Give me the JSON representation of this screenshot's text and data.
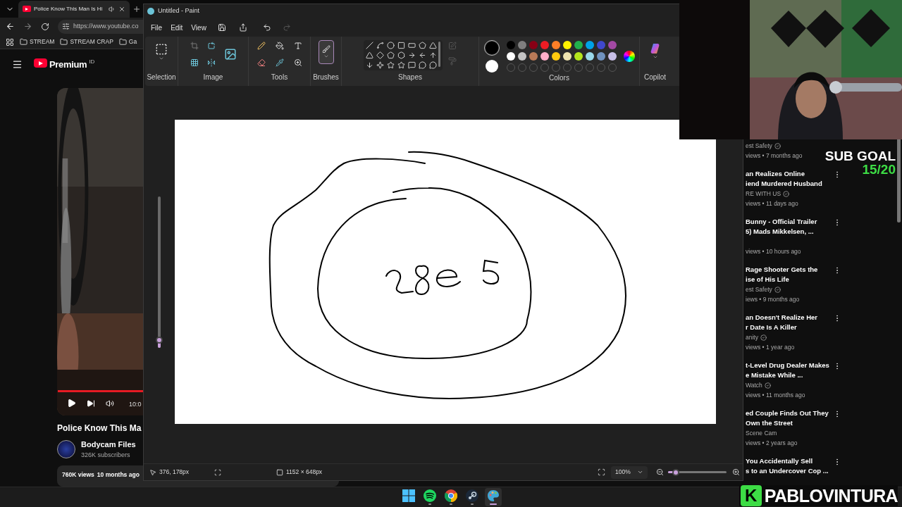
{
  "browser": {
    "tab": {
      "title": "Police Know This Man Is Hi",
      "selected": true
    },
    "address": "https://www.youtube.co",
    "bookmarks": [
      "STREAM",
      "STREAM CRAP",
      "Ga"
    ],
    "logo": "Premium",
    "logo_badge": "ID",
    "video": {
      "time": "10:0",
      "title": "Police Know This Ma",
      "channel": "Bodycam Files",
      "subscribers": "326K subscribers",
      "views": "760K views",
      "age": "10 months ago"
    },
    "recommendations": [
      {
        "channel": "est Safety",
        "verified": true,
        "meta": "views • 7 months ago"
      },
      {
        "title_lines": [
          "an Realizes Online",
          "iend Murdered Husband"
        ],
        "channel": "RE WITH US",
        "verified": true,
        "meta": "views • 11 days ago"
      },
      {
        "title_lines": [
          "Bunny - Official Trailer",
          "5) Mads Mikkelsen, ..."
        ],
        "meta": "views • 10 hours ago"
      },
      {
        "title_lines": [
          "Rage Shooter Gets the",
          "ise of His Life"
        ],
        "channel": "est Safety",
        "verified": true,
        "meta": "iews • 9 months ago"
      },
      {
        "title_lines": [
          "an Doesn't Realize Her",
          "r Date Is A Killer"
        ],
        "channel": "anity",
        "verified": true,
        "meta": "views • 1 year ago"
      },
      {
        "title_lines": [
          "t-Level Drug Dealer Makes",
          "e Mistake While ..."
        ],
        "channel": "Watch",
        "verified": true,
        "meta": "views • 11 months ago"
      },
      {
        "title_lines": [
          "ed Couple Finds Out They",
          "Own the Street"
        ],
        "channel": "Scene Cam",
        "verified": false,
        "meta": "views • 2 years ago"
      },
      {
        "title_lines": [
          "You Accidentally Sell",
          "s to an Undercover Cop ..."
        ]
      }
    ]
  },
  "paint": {
    "title": "Untitled - Paint",
    "menus": [
      "File",
      "Edit",
      "View"
    ],
    "redo_disabled": true,
    "groups": [
      "Selection",
      "Image",
      "Tools",
      "Brushes",
      "Shapes",
      "Colors",
      "Copilot"
    ],
    "primary": {
      "color": "#000000"
    },
    "secondary": {
      "color": "#ffffff"
    },
    "palette": [
      {
        "kind": "color",
        "color": "#000000"
      },
      {
        "kind": "color",
        "color": "#7f7f7f"
      },
      {
        "kind": "color",
        "color": "#880015"
      },
      {
        "kind": "color",
        "color": "#ed1c24"
      },
      {
        "kind": "color",
        "color": "#ff7f27"
      },
      {
        "kind": "color",
        "color": "#fff200"
      },
      {
        "kind": "color",
        "color": "#22b14c"
      },
      {
        "kind": "color",
        "color": "#00a2e8"
      },
      {
        "kind": "color",
        "color": "#3f48cc"
      },
      {
        "kind": "color",
        "color": "#a349a4"
      },
      {
        "kind": "color",
        "color": "#ffffff"
      },
      {
        "kind": "color",
        "color": "#c3c3c3"
      },
      {
        "kind": "color",
        "color": "#b97a57"
      },
      {
        "kind": "color",
        "color": "#ffaec9"
      },
      {
        "kind": "color",
        "color": "#ffc90e"
      },
      {
        "kind": "color",
        "color": "#efe4b0"
      },
      {
        "kind": "color",
        "color": "#b5e61d"
      },
      {
        "kind": "color",
        "color": "#99d9ea"
      },
      {
        "kind": "color",
        "color": "#7092be"
      },
      {
        "kind": "color",
        "color": "#c8bfe7"
      },
      {
        "kind": "empty"
      },
      {
        "kind": "empty"
      },
      {
        "kind": "empty"
      },
      {
        "kind": "empty"
      },
      {
        "kind": "empty"
      },
      {
        "kind": "empty"
      },
      {
        "kind": "empty"
      },
      {
        "kind": "empty"
      },
      {
        "kind": "empty"
      },
      {
        "kind": "empty"
      }
    ],
    "brush_size": {
      "level": 0.05
    },
    "status": {
      "cursor": "376, 178px",
      "size": "1152 × 648px",
      "zoom": "100%"
    },
    "zoom_slider": {
      "level": 0.13
    }
  },
  "overlay": {
    "sub_goal": "SUB GOAL",
    "sub_count": "15/20",
    "logo_letter": "K",
    "streamer": "PABLOVINTURA"
  },
  "taskbar": {
    "apps": [
      {
        "kind": "start",
        "running": false,
        "selected": false
      },
      {
        "kind": "music",
        "running": true,
        "selected": false
      },
      {
        "kind": "browser",
        "running": true,
        "selected": false
      },
      {
        "kind": "games",
        "running": true,
        "selected": false
      },
      {
        "kind": "paint",
        "running": true,
        "selected": true
      }
    ]
  }
}
